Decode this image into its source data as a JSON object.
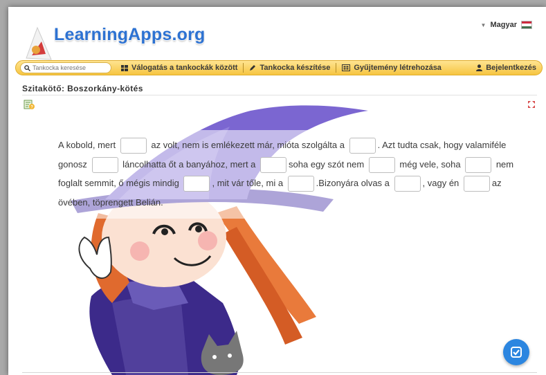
{
  "header": {
    "logo_text": "LearningApps.org",
    "language": "Magyar"
  },
  "navbar": {
    "search_placeholder": "Tankocka keresése",
    "browse": "Válogatás a tankockák között",
    "create": "Tankocka készítése",
    "collection": "Gyűjtemény létrehozása",
    "login": "Bejelentkezés"
  },
  "page": {
    "title": "Szitakötő: Boszorkány-kötés"
  },
  "exercise": {
    "segments": [
      "A kobold, mert",
      "az volt, nem is emlékezett már, mióta szolgálta a",
      ". Azt tudta csak, hogy valamiféle gonosz",
      "láncolhatta őt a banyához, mert a",
      "soha egy szót nem",
      "még vele, soha",
      "nem foglalt semmit, ő mégis mindig",
      ", mit vár tőle, mi a",
      ".Bizonyára olvas a",
      ", vagy én",
      "az övében, töprengett Belián."
    ],
    "gaps": [
      "",
      "",
      "",
      "",
      "",
      "",
      "",
      "",
      "",
      ""
    ]
  },
  "colors": {
    "accent": "#2d72d2",
    "navbar": "#f6c541",
    "check_button": "#2c86e0"
  },
  "icons": [
    "search-icon",
    "grid-icon",
    "pencil-icon",
    "collection-icon",
    "user-icon",
    "help-icon",
    "expand-icon",
    "check-icon"
  ]
}
